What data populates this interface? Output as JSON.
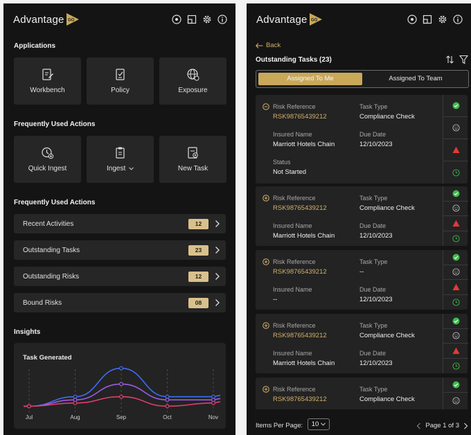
{
  "brand": {
    "name": "Advantage",
    "mark_text": "GO",
    "accent": "#c9a85a"
  },
  "left": {
    "applications_title": "Applications",
    "apps": [
      {
        "label": "Workbench",
        "icon": "edit-document-icon"
      },
      {
        "label": "Policy",
        "icon": "policy-document-icon"
      },
      {
        "label": "Exposure",
        "icon": "globe-icon"
      }
    ],
    "frequent_actions_title": "Frequently Used Actions",
    "quick_actions": [
      {
        "label": "Quick Ingest",
        "icon": "clock-plus-icon"
      },
      {
        "label": "Ingest",
        "icon": "clipboard-icon",
        "dropdown": true
      },
      {
        "label": "New Task",
        "icon": "new-task-icon"
      }
    ],
    "frequent_actions_title_2": "Frequently Used Actions",
    "action_rows": [
      {
        "label": "Recent Activities",
        "count": "12"
      },
      {
        "label": "Outstanding Tasks",
        "count": "23"
      },
      {
        "label": "Outstanding Risks",
        "count": "12"
      },
      {
        "label": "Bound Risks",
        "count": "08"
      }
    ],
    "insights_title": "Insights"
  },
  "chart_data": {
    "type": "line",
    "title": "Task Generated",
    "categories": [
      "Jul",
      "Aug",
      "Sep",
      "Oct",
      "Nov"
    ],
    "series": [
      {
        "color": "#3f6df5",
        "values": [
          1,
          4,
          13,
          4,
          4
        ]
      },
      {
        "color": "#9b5de5",
        "values": [
          1,
          3,
          8,
          3,
          3
        ]
      },
      {
        "color": "#e53c6e",
        "values": [
          1,
          2,
          4,
          1,
          2
        ]
      }
    ],
    "ylim": [
      0,
      14
    ],
    "grid": "vertical dashed"
  },
  "right": {
    "back_label": "Back",
    "list_title": "Outstanding Tasks (23)",
    "tabs": {
      "active": "Assigned To Me",
      "inactive": "Assigned To Team"
    },
    "labels": {
      "risk_reference": "Risk Reference",
      "task_type": "Task Type",
      "insured_name": "Insured Name",
      "due_date": "Due Date",
      "status": "Status"
    },
    "tasks": [
      {
        "risk_reference": "RSK98765439212",
        "task_type": "Compliance Check",
        "insured_name": "Marriott Hotels Chain",
        "due_date": "12/10/2023",
        "status": "Not Started",
        "expanded": true
      },
      {
        "risk_reference": "RSK98765439212",
        "task_type": "Compliance Check",
        "insured_name": "Marriott Hotels Chain",
        "due_date": "12/10/2023",
        "expanded": false
      },
      {
        "risk_reference": "RSK98765439212",
        "task_type": "--",
        "insured_name": "--",
        "due_date": "12/10/2023",
        "expanded": false
      },
      {
        "risk_reference": "RSK98765439212",
        "task_type": "Compliance Check",
        "insured_name": "Marriott Hotels Chain",
        "due_date": "12/10/2023",
        "expanded": false
      },
      {
        "risk_reference": "RSK98765439212",
        "task_type": "Compliance Check",
        "expanded": false
      }
    ],
    "status_colors": {
      "ok": "#3dbb4a",
      "warn": "#e53935",
      "neutral": "#bdbdbd"
    },
    "footer": {
      "items_per_page_label": "Items Per Page:",
      "items_per_page_value": "10",
      "page_label": "Page 1 of 3"
    }
  }
}
